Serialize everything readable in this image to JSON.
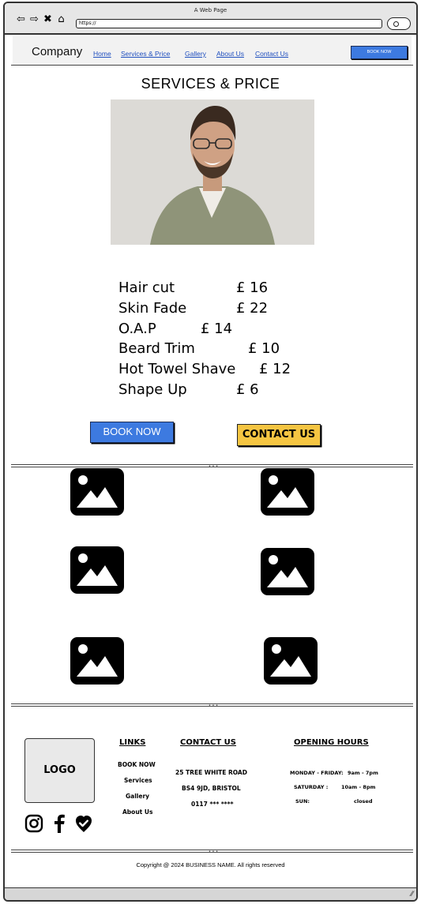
{
  "browser": {
    "window_title": "A Web Page",
    "url": "https://",
    "nav_icons": [
      "back-icon",
      "forward-icon",
      "stop-icon",
      "home-icon"
    ]
  },
  "header": {
    "brand": "Company",
    "nav": [
      "Home",
      "Services & Price",
      "Gallery",
      "About Us",
      "Contact Us"
    ],
    "book_now": "BOOK NOW"
  },
  "services": {
    "title": "SERVICES & PRICE",
    "items": [
      {
        "name": "Hair cut",
        "price": "£ 16"
      },
      {
        "name": "Skin Fade",
        "price": "£ 22"
      },
      {
        "name": "O.A.P",
        "price": "£ 14"
      },
      {
        "name": "Beard Trim",
        "price": "£ 10"
      },
      {
        "name": "Hot Towel Shave",
        "price": "£ 12"
      },
      {
        "name": "Shape Up",
        "price": "£ 6"
      }
    ],
    "book_now": "BOOK NOW",
    "contact_us": "CONTACT US"
  },
  "gallery": {
    "count": 6,
    "icon": "image-placeholder-icon"
  },
  "footer": {
    "logo": "LOGO",
    "social_icons": [
      "instagram-icon",
      "facebook-icon",
      "verified-icon"
    ],
    "links_heading": "LINKS",
    "links": [
      "BOOK NOW",
      "Services",
      "Gallery",
      "About Us"
    ],
    "contact_heading": "CONTACT US",
    "contact_lines": [
      "25 TREE WHITE ROAD",
      "BS4 9JD, BRISTOL",
      "0117 *** ****"
    ],
    "hours_heading": "OPENING HOURS",
    "hours": [
      {
        "day": "MONDAY - FRIDAY:",
        "time": "9am - 7pm"
      },
      {
        "day": "SATURDAY :",
        "time": "10am - 8pm"
      },
      {
        "day": "SUN:",
        "time": "closed"
      }
    ],
    "copyright": "Copyright @ 2024 BUSINESS NAME. All rights reserved"
  },
  "colors": {
    "primary_button": "#3d7ae0",
    "contact_button": "#f5c542",
    "nav_link": "#1f4fbf",
    "header_bg": "#f2f2f2"
  }
}
